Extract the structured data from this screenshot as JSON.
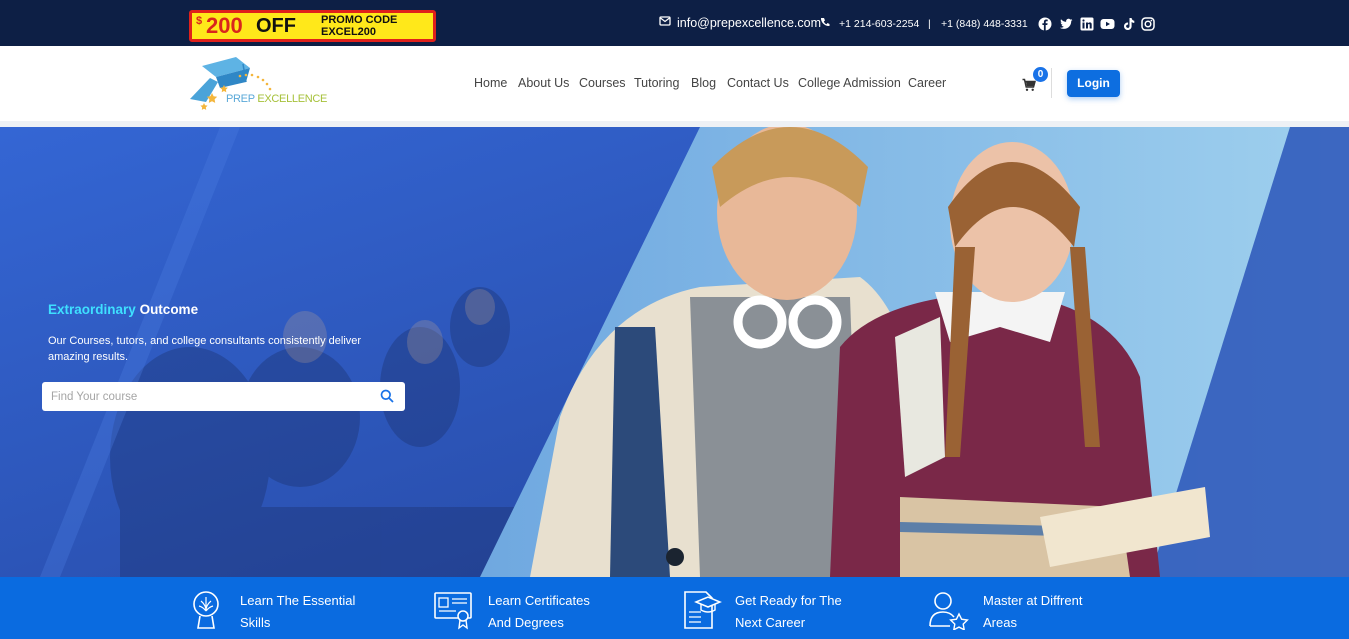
{
  "promo": {
    "currency": "$",
    "amount": "200",
    "off": "OFF",
    "code_label": "PROMO CODE",
    "code": "EXCEL200"
  },
  "topbar": {
    "email": "info@prepexcellence.com",
    "phone1": "+1 214-603-2254",
    "separator": "|",
    "phone2": "+1 (848) 448-3331",
    "social": [
      "facebook-icon",
      "twitter-icon",
      "linkedin-icon",
      "youtube-icon",
      "tiktok-icon",
      "instagram-icon"
    ]
  },
  "logo": {
    "text_part1": "PREP",
    "text_part2": "EXCELLENCE"
  },
  "nav": {
    "items": [
      "Home",
      "About Us",
      "Courses",
      "Tutoring",
      "Blog",
      "Contact Us",
      "College Admission",
      "Career"
    ]
  },
  "cart": {
    "count": "0"
  },
  "login_label": "Login",
  "hero": {
    "title_accent": "Extraordinary",
    "title_rest": "Outcome",
    "subtitle": "Our Courses, tutors, and college consultants consistently deliver amazing results.",
    "search_placeholder": "Find Your course"
  },
  "features": [
    {
      "icon": "brain-head-icon",
      "line1": "Learn The Essential",
      "line2": "Skills"
    },
    {
      "icon": "certificate-icon",
      "line1": "Learn Certificates",
      "line2": "And Degrees"
    },
    {
      "icon": "career-document-icon",
      "line1": "Get Ready for The",
      "line2": "Next Career"
    },
    {
      "icon": "person-star-icon",
      "line1": "Master at Diffrent",
      "line2": "Areas"
    }
  ],
  "colors": {
    "topbar_bg": "#0d1f45",
    "accent_blue": "#0d6ee0",
    "band_blue": "#0a6be0",
    "hero_accent": "#3ee0ff",
    "promo_yellow": "#ffe81a",
    "promo_red": "#e0211b"
  }
}
